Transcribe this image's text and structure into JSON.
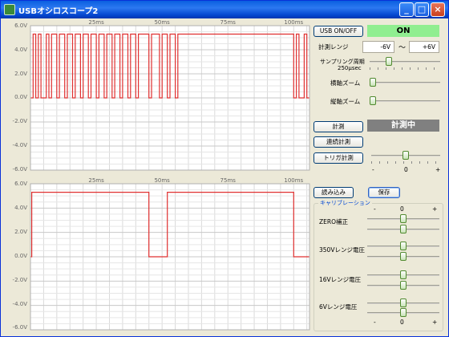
{
  "window": {
    "title": "USBオシロスコープ2",
    "minimize": "_",
    "maximize": "□",
    "close": "×"
  },
  "plot_top": {
    "x_ticks": [
      "25ms",
      "50ms",
      "75ms",
      "100ms"
    ],
    "y_labels": [
      "6.0V",
      "4.0V",
      "2.0V",
      "0.0V",
      "-2.0V",
      "-4.0V",
      "-6.0V"
    ]
  },
  "plot_bottom": {
    "x_ticks": [
      "25ms",
      "50ms",
      "75ms",
      "100ms"
    ],
    "y_labels": [
      "6.0V",
      "4.0V",
      "2.0V",
      "0.0V",
      "-2.0V",
      "-4.0V",
      "-6.0V"
    ]
  },
  "controls": {
    "usb_button": "USB ON/OFF",
    "usb_status": "ON",
    "range_label": "計測レンジ",
    "range_min": "-6V",
    "range_tilde": "～",
    "range_max": "+6V",
    "sampling_label_1": "サンプリング周期",
    "sampling_label_2": "250μsec",
    "horizontal_zoom_label": "横軸ズーム",
    "vertical_zoom_label": "縦軸ズーム",
    "measure_button": "計測",
    "measure_status": "計測中",
    "continuous_button": "連続計測",
    "trigger_button": "トリガ計測",
    "trigger_minus": "-",
    "trigger_value": "0",
    "trigger_plus": "+",
    "load_button": "読み込み",
    "save_button": "保存"
  },
  "calibration": {
    "title": "キャリブレーション",
    "top_minus": "-",
    "top_value": "0",
    "top_plus": "+",
    "zero_label": "ZERO補正",
    "range350_label": "350Vレンジ電圧",
    "range16_label": "16Vレンジ電圧",
    "range6_label": "6Vレンジ電圧",
    "bottom_minus": "-",
    "bottom_value": "0",
    "bottom_plus": "+"
  },
  "colors": {
    "waveform": "#E03030",
    "status_on": "#90EE90",
    "status_measuring": "#808080"
  },
  "chart_data": [
    {
      "type": "line",
      "xlabel": "",
      "ylabel": "",
      "x_ticks": [
        "25ms",
        "50ms",
        "75ms",
        "100ms"
      ],
      "ylim": [
        -6,
        6
      ],
      "y_ticks": [
        6,
        4,
        2,
        0,
        -2,
        -4,
        -6
      ],
      "series": [
        {
          "x": [
            0,
            1,
            1,
            2,
            2,
            3,
            3,
            4,
            4,
            6,
            6,
            7,
            7,
            8,
            8,
            10,
            10,
            11,
            11,
            13,
            13,
            14,
            14,
            16,
            16,
            17,
            17,
            19,
            19,
            20,
            20,
            22,
            22,
            23,
            23,
            25,
            25,
            26,
            26,
            28,
            28,
            29,
            29,
            31,
            31,
            32,
            32,
            34,
            34,
            35,
            35,
            37,
            37,
            38,
            38,
            40,
            40,
            41,
            41,
            45,
            45,
            46,
            46,
            49,
            49,
            50,
            50,
            52,
            52,
            53,
            53,
            55,
            55,
            56,
            56,
            100,
            100,
            101,
            101,
            102,
            102,
            104,
            104,
            105,
            105,
            106
          ],
          "y": [
            0,
            0,
            5.3,
            5.3,
            0,
            0,
            5.3,
            5.3,
            0,
            0,
            5.3,
            5.3,
            0,
            0,
            5.3,
            5.3,
            0,
            0,
            5.3,
            5.3,
            0,
            0,
            5.3,
            5.3,
            0,
            0,
            5.3,
            5.3,
            0,
            0,
            5.3,
            5.3,
            0,
            0,
            5.3,
            5.3,
            0,
            0,
            5.3,
            5.3,
            0,
            0,
            5.3,
            5.3,
            0,
            0,
            5.3,
            5.3,
            0,
            0,
            5.3,
            5.3,
            0,
            0,
            5.3,
            5.3,
            0,
            0,
            5.3,
            5.3,
            0,
            0,
            5.3,
            5.3,
            0,
            0,
            5.3,
            5.3,
            0,
            0,
            5.3,
            5.3,
            0,
            0,
            5.3,
            5.3,
            0,
            0,
            5.3,
            5.3,
            0,
            0,
            5.3,
            5.3,
            0,
            0
          ]
        }
      ]
    },
    {
      "type": "line",
      "xlabel": "",
      "ylabel": "",
      "x_ticks": [
        "25ms",
        "50ms",
        "75ms",
        "100ms"
      ],
      "ylim": [
        -6,
        6
      ],
      "y_ticks": [
        6,
        4,
        2,
        0,
        -2,
        -4,
        -6
      ],
      "series": [
        {
          "x": [
            0,
            0.5,
            0.5,
            45,
            45,
            52,
            52,
            100,
            100,
            106
          ],
          "y": [
            0,
            0,
            5.3,
            5.3,
            0,
            0,
            5.3,
            5.3,
            0,
            0
          ]
        }
      ]
    }
  ]
}
